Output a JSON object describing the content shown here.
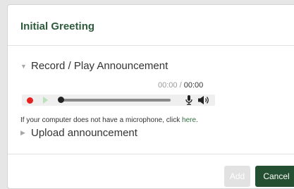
{
  "dialog": {
    "title": "Initial Greeting",
    "record_section": {
      "label": "Record / Play Announcement",
      "expanded": true
    },
    "player": {
      "current_time": "00:00",
      "separator": " / ",
      "duration": "00:00",
      "progress": 0,
      "icons": [
        "record-icon",
        "play-icon",
        "microphone-icon",
        "volume-icon"
      ]
    },
    "microphone_hint": {
      "text": "If your computer does not have a microphone, click ",
      "link": "here",
      "suffix": "."
    },
    "upload_section": {
      "label": "Upload announcement",
      "expanded": false
    },
    "buttons": {
      "add": "Add",
      "cancel": "Cancel"
    }
  },
  "colors": {
    "title": "#2e5b3c",
    "record": "#e81f1f",
    "play_disabled": "#b9e2b9",
    "cancel_bg": "#244f30",
    "add_disabled_bg": "#e2e2e2",
    "link": "#2e6e3f"
  }
}
